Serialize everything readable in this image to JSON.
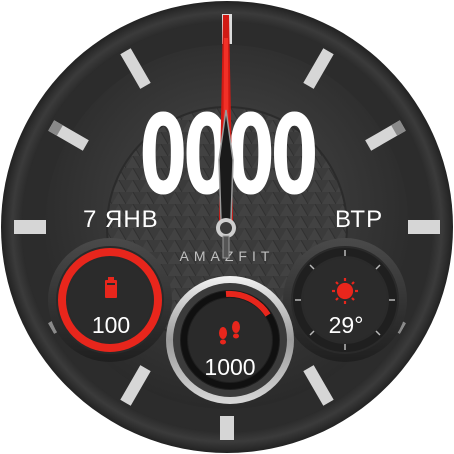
{
  "watch": {
    "time_digits": "0000",
    "date": "7 ЯНВ",
    "weekday": "ВТР",
    "brand": "AMAZFIT"
  },
  "battery": {
    "icon": "battery-icon",
    "value": "100",
    "level": 1.0,
    "accent": "#e8261c"
  },
  "steps": {
    "icon": "footsteps-icon",
    "value": "1000",
    "progress": 0.12,
    "accent": "#e8261c"
  },
  "weather": {
    "icon": "sun-icon",
    "value": "29°",
    "accent": "#e8261c"
  },
  "colors": {
    "bezel": "#2b2b2b",
    "dial": "#3a3a3a",
    "hand": "#d11a14",
    "text": "#ffffff"
  }
}
